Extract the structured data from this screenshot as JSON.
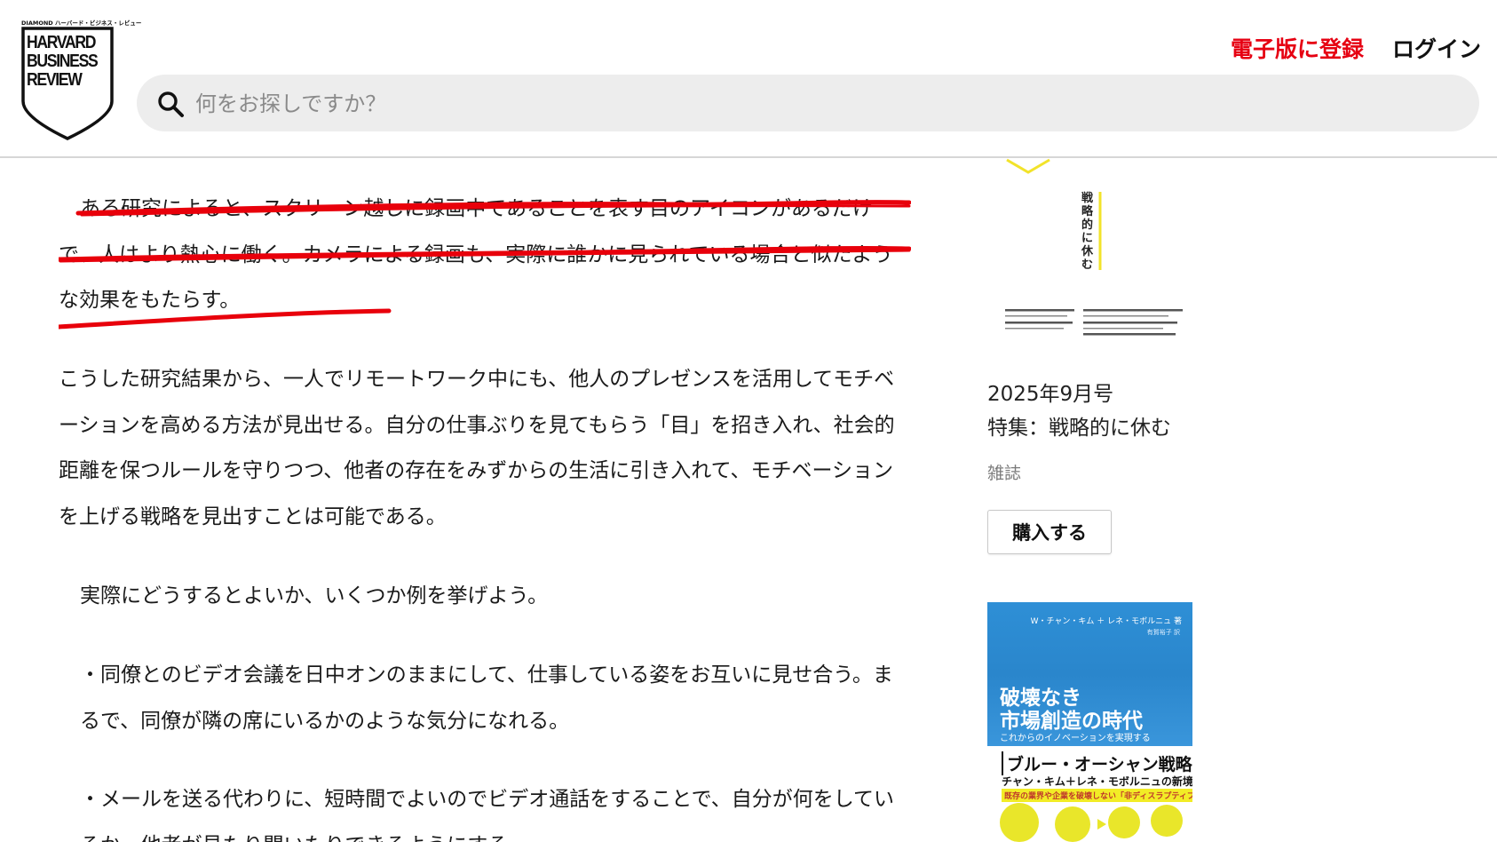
{
  "header": {
    "logo_brand": "DIAMOND ハーバード・ビジネス・レビュー",
    "logo_words": [
      "HARVARD",
      "BUSINESS",
      "REVIEW"
    ],
    "signup_label": "電子版に登録",
    "login_label": "ログイン",
    "search_placeholder": "何をお探しですか？"
  },
  "article": {
    "paragraphs": [
      "ある研究によると、スクリーン越しに録画中であることを表す目のアイコンがあるだけで、人はより熱心に働く。カメラによる録画も、実際に誰かに見られている場合と似たような効果をもたらす。",
      "こうした研究結果から、一人でリモートワーク中にも、他人のプレゼンスを活用してモチベーションを高める方法が見出せる。自分の仕事ぶりを見てもらう「目」を招き入れ、社会的距離を保つルールを守りつつ、他者の存在をみずからの生活に引き入れて、モチベーションを上げる戦略を見出すことは可能である。",
      "実際にどうするとよいか、いくつか例を挙げよう。",
      "・同僚とのビデオ会議を日中オンのままにして、仕事している姿をお互いに見せ合う。まるで、同僚が隣の席にいるかのような気分になれる。",
      "・メールを送る代わりに、短時間でよいのでビデオ通話をすることで、自分が何をしているか、他者が見たり聞いたりできるようにする。"
    ],
    "highlight_color": "#e8000b"
  },
  "sidebar": {
    "magazine_cover_title": "戦略的に休む",
    "issue_date": "2025年9月号",
    "issue_title": "特集：戦略的に休む",
    "category": "雑誌",
    "buy_label": "購入する",
    "book": {
      "authors": "W・チャン・キム ＋ レネ・モボルニュ 著",
      "translator": "有賀裕子 訳",
      "title_line1": "破壊なき",
      "title_line2": "市場創造の時代",
      "tagline": "これからのイノベーションを実現する",
      "series": "ブルー・オーシャン戦略",
      "subtitle": "チャン・キム＋レネ・モボルニュの新境地",
      "band": "既存の業界や企業を破壊しない「非ディスラプティブな創造」へ"
    }
  },
  "colors": {
    "brand_red": "#e60012",
    "search_bg": "#ededed",
    "book_blue": "#2e8fd6",
    "book_yellow": "#f2ec26"
  }
}
